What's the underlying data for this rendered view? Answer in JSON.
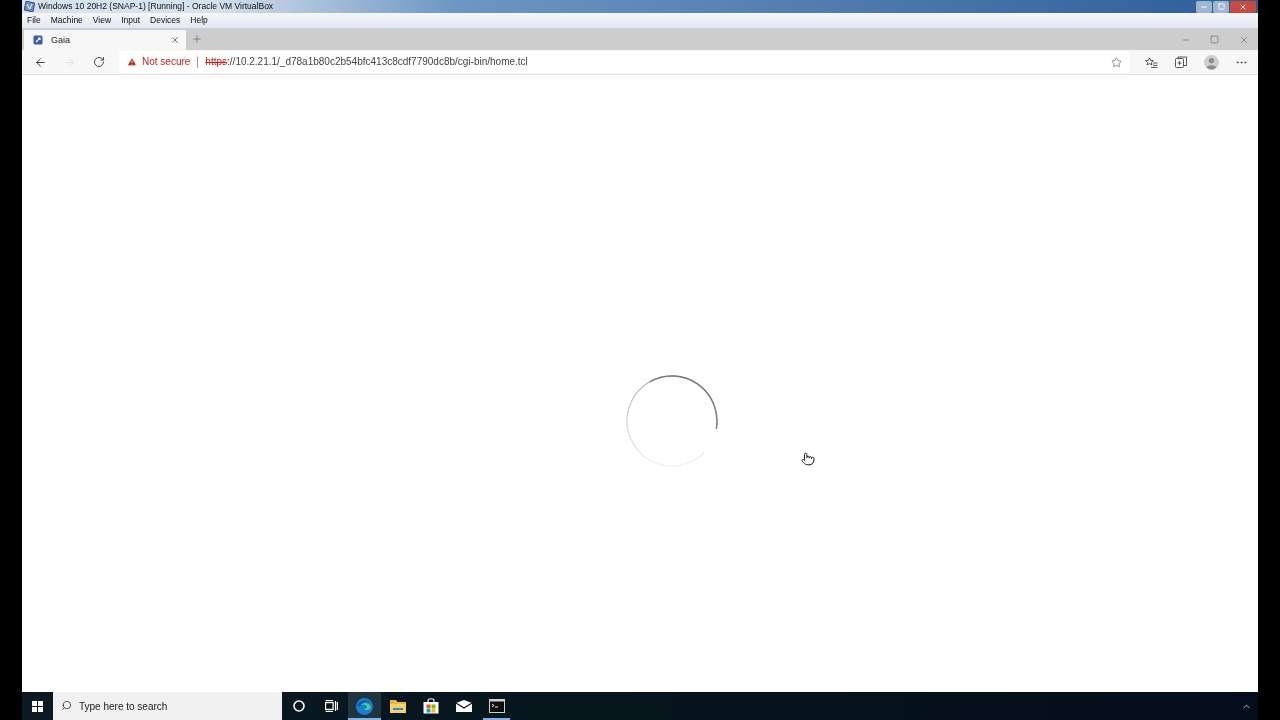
{
  "vm_window": {
    "title": "Windows 10 20H2 (SNAP-1) [Running] - Oracle VM VirtualBox",
    "menu": [
      "File",
      "Machine",
      "View",
      "Input",
      "Devices",
      "Help"
    ]
  },
  "browser": {
    "tabs": [
      {
        "title": "Gaia",
        "selected": true
      }
    ],
    "nav": [
      {
        "kind": "back",
        "disabled": false
      },
      {
        "kind": "forward",
        "disabled": true
      },
      {
        "kind": "refresh",
        "disabled": false
      }
    ],
    "address": {
      "security": "Not secure",
      "scheme": "https",
      "rest": "://10.2.21.1/_d78a1b80c2b54bfc413c8cdf7790dc8b/cgi-bin/home.tcl"
    }
  },
  "page": {
    "loading": true
  },
  "taskbar": {
    "search_placeholder": "Type here to search",
    "apps": [
      {
        "kind": "cortana",
        "selected": false,
        "running": false
      },
      {
        "kind": "task-view",
        "selected": false,
        "running": false
      },
      {
        "kind": "edge",
        "selected": true,
        "running": true
      },
      {
        "kind": "file-explorer",
        "selected": false,
        "running": false
      },
      {
        "kind": "store",
        "selected": false,
        "running": false
      },
      {
        "kind": "mail",
        "selected": false,
        "running": false
      },
      {
        "kind": "terminal",
        "selected": false,
        "running": true
      }
    ]
  }
}
